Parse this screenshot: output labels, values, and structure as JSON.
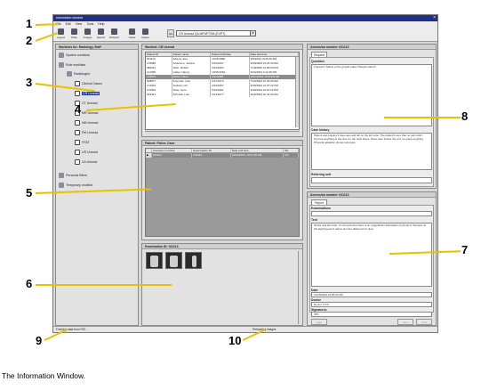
{
  "window": {
    "title": "Information window",
    "close_icon": "close-icon",
    "menu": [
      "File",
      "Edit",
      "View",
      "Tools",
      "Help"
    ]
  },
  "toolbar": {
    "buttons": [
      {
        "label": "Logout",
        "icon": "logout-icon"
      },
      {
        "label": "Write",
        "icon": "write-icon"
      },
      {
        "label": "Images",
        "icon": "images-icon"
      },
      {
        "label": "Search",
        "icon": "search-icon"
      },
      {
        "label": "Refresh",
        "icon": "refresh-icon"
      },
      {
        "label": "Close",
        "icon": "close-case-icon"
      },
      {
        "label": "Cases",
        "icon": "cases-icon"
      }
    ],
    "worklist_button": "QA",
    "worklist_select": "CR Unread QA  MFNPTSM  (EXPT)"
  },
  "navigator": {
    "title": "Worklists for: Radiology Staff",
    "items": [
      {
        "label": "System worklists"
      },
      {
        "label": "Role worklists"
      },
      {
        "label": "Radiologist"
      },
      {
        "label": "Clinical Cases"
      },
      {
        "label": "CR Unread"
      },
      {
        "label": "CT Unread"
      },
      {
        "label": "MR Unread"
      },
      {
        "label": "NM Unread"
      },
      {
        "label": "Pet Unread"
      },
      {
        "label": "STAT"
      },
      {
        "label": "US Unread"
      },
      {
        "label": "XA Unread"
      },
      {
        "label": "Personal filters"
      },
      {
        "label": "Temporary worklist"
      }
    ]
  },
  "worklist": {
    "title": "Worklist: CR Unread",
    "columns": [
      "Patient ID",
      "Patient name",
      "Patient birthdate",
      "Date and time"
    ],
    "rows": [
      [
        "001113",
        "Adams, Eva",
        "11/05/1968",
        "9/5/2004 10:26:20 AM"
      ],
      [
        "178086",
        "Anderson, Jeanne",
        "5/15/1997",
        "9/30/2004 10:26:30 AM"
      ],
      [
        "080012",
        "Allen, Robert",
        "3/12/1953",
        "7/19/2002 12:05:00 PM"
      ],
      [
        "121395",
        "Carter, Nancy",
        "10/25/1962",
        "9/24/2004 3:12:25 PM"
      ],
      [
        "126813",
        "Fisher, Dave",
        "2/11/1980",
        "10/11/2004 10:41:00 AM"
      ],
      [
        "528877",
        "Freeman, Lisa",
        "6/17/1974",
        "7/22/2004 10:40:00 AM"
      ],
      [
        "172003",
        "Jackson, Ali",
        "4/19/1957",
        "9/30/2004 12:07:22 PM"
      ],
      [
        "172030",
        "Ross, Sam",
        "5/19/1961",
        "9/30/2004 12:07:22 PM"
      ],
      [
        "003441",
        "Schmidt, Lisa",
        "3/14/1977",
        "9/22/2004 10:41:00 AM"
      ]
    ],
    "selected_row": 4
  },
  "exams": {
    "title": "Patient: Fisher, Dave",
    "columns": [
      "",
      "Accession number",
      "Examination ID",
      "Date and time",
      "Mo"
    ],
    "rows": [
      [
        "▶",
        "041113",
        "041113",
        "10/11/2004, 10:41:25 AM",
        "CR"
      ]
    ]
  },
  "images": {
    "title": "Examination ID: 041113",
    "thumbnails": 3
  },
  "request_panel": {
    "title": "Accession number: 041113",
    "tab": "Request",
    "question_label": "Question",
    "question_text": "Fracture? Status of the growth plate? Weight status?",
    "case_history_label": "Case history",
    "case_history_text": "Patient was playing 3 days ago and fell on the left wrist. The patient's rays that no pain didn't improve anything at the time for the wrist brace. Rises also shows the arm no grasp anything. Physical palpation shows soreness.",
    "referring_unit_label": "Referring unit",
    "referring_unit_value": ""
  },
  "report_panel": {
    "title": "Accession number: 041113",
    "tab": "Report",
    "examinations_label": "Examinations",
    "examinations_value": "",
    "text_label": "Text",
    "text_value": "Wrists and left wrist. On the left wrist there is an insignificant dislocation proximal in fractures at the Epiphyseal of radius and the distal part of ulna.",
    "date_label": "Date",
    "date_value": "10/15/2004 10:05:00 AM",
    "doctor_label": "Doctor",
    "doctor_value": "Doctor 1 P.D.",
    "signatures_label": "Signatures",
    "signatures_value": "JPK",
    "buttons": [
      "Sign",
      "Save",
      "Print"
    ]
  },
  "status": {
    "left": "Fetching data from RIS ...",
    "right": "Preloading images"
  },
  "callouts": [
    "1",
    "2",
    "3",
    "4",
    "5",
    "6",
    "7",
    "8",
    "9",
    "10"
  ],
  "caption": "The Information Window.",
  "colors": {
    "selection": "#1d3f99",
    "leader": "#e6c200",
    "titlebar": "#20308a"
  }
}
